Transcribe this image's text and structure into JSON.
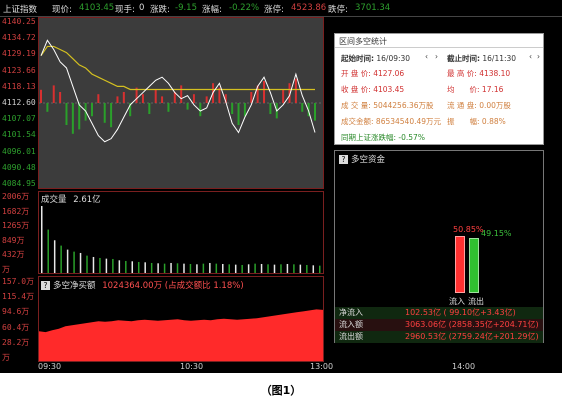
{
  "header": {
    "index_name": "上证指数",
    "current_label": "现价:",
    "current_value": "4103.45",
    "hand_label": "现手:",
    "hand_value": "0",
    "change_label": "涨跌:",
    "change_value": "-9.15",
    "pct_label": "涨幅:",
    "pct_value": "-0.22%",
    "limit_up_label": "涨停:",
    "limit_up_value": "4523.86",
    "limit_down_label": "跌停:",
    "limit_down_value": "3701.34"
  },
  "price_axis": [
    "4140.25",
    "4134.72",
    "4129.19",
    "4123.66",
    "4118.13",
    "4112.60",
    "4107.07",
    "4101.54",
    "4096.01",
    "4090.48",
    "4084.95"
  ],
  "volume_pane": {
    "label": "成交量",
    "value": "2.61亿",
    "axis": [
      "2006万",
      "1682万",
      "1265万",
      "849万",
      "432万",
      "万"
    ]
  },
  "net_pane": {
    "label": "多空净买额",
    "value": "1024364.00万",
    "ratio": "(占成交额比 1.18%)",
    "axis": [
      "157.0万",
      "115.4万",
      "94.6万",
      "60.4万",
      "28.2万",
      "万"
    ]
  },
  "time_axis": [
    "09:30",
    "10:30",
    "13:00",
    "14:00"
  ],
  "stats": {
    "title": "区间多空统计",
    "start_label": "起始时间:",
    "start_value": "16/09:30",
    "end_label": "截止时间:",
    "end_value": "16/11:30",
    "open_label": "开 盘 价:",
    "open_value": "4127.06",
    "high_label": "最 高 价:",
    "high_value": "4138.10",
    "close_label": "收 盘 价:",
    "close_value": "4103.45",
    "avg_label": "均　　价:",
    "avg_value": "17.16",
    "vol_label": "成 交 量:",
    "vol_value": "5044256.36万股",
    "float_label": "流 通 盘:",
    "float_value": "0.00万股",
    "amount_label": "成交金额:",
    "amount_value": "86534540.49万元",
    "swing_label": "振　　幅:",
    "swing_value": "0.88%",
    "period_label": "同期上证涨跌幅:",
    "period_value": "-0.57%"
  },
  "capital": {
    "title": "多空资金",
    "inflow_pct": "50.85%",
    "outflow_pct": "49.15%",
    "inflow_label": "流入",
    "outflow_label": "流出",
    "rows": [
      {
        "k": "净流入",
        "v": "102.53亿 ( 99.10亿+3.43亿)"
      },
      {
        "k": "流入额",
        "v": "3063.06亿 (2858.35亿+204.71亿)"
      },
      {
        "k": "流出额",
        "v": "2960.53亿 (2759.24亿+201.29亿)"
      }
    ]
  },
  "caption": "（图1）",
  "chart_data": {
    "type": "line",
    "price_range": [
      4084.95,
      4140.25
    ],
    "price_series": [
      4128,
      4133,
      4130,
      4126,
      4124,
      4118,
      4112,
      4110,
      4106,
      4102,
      4100,
      4101,
      4104,
      4108,
      4112,
      4114,
      4116,
      4118,
      4120,
      4121,
      4119,
      4116,
      4114,
      4115,
      4112,
      4110,
      4111,
      4116,
      4119,
      4113,
      4106,
      4103,
      4108,
      4112,
      4118,
      4121,
      4116,
      4110,
      4112,
      4115,
      4122,
      4115,
      4110,
      4103
    ],
    "avg_series": [
      4128,
      4131,
      4131,
      4130,
      4129,
      4127,
      4125,
      4124,
      4122,
      4121,
      4120,
      4119,
      4118,
      4118,
      4117,
      4117,
      4117,
      4117,
      4117,
      4117,
      4117,
      4117,
      4117,
      4117,
      4117,
      4117,
      4117,
      4117,
      4117,
      4117,
      4117,
      4117,
      4117,
      4117,
      4117,
      4117,
      4117,
      4117,
      4117,
      4117,
      4117,
      4117,
      4117,
      4117
    ],
    "bars": [
      6,
      -4,
      8,
      5,
      -10,
      -14,
      -12,
      -8,
      -6,
      4,
      -9,
      -11,
      3,
      5,
      -6,
      7,
      4,
      -5,
      6,
      3,
      -4,
      5,
      8,
      -3,
      4,
      -6,
      3,
      9,
      7,
      4,
      -5,
      -10,
      -6,
      5,
      8,
      10,
      -5,
      -7,
      6,
      9,
      11,
      -4,
      -6,
      -8
    ],
    "volume": [
      2006,
      1300,
      980,
      820,
      700,
      640,
      600,
      520,
      480,
      450,
      430,
      420,
      380,
      360,
      350,
      330,
      320,
      300,
      290,
      280,
      300,
      290,
      280,
      270,
      260,
      280,
      300,
      280,
      270,
      260,
      250,
      240,
      260,
      280,
      270,
      260,
      250,
      260,
      270,
      260,
      250,
      240,
      230,
      220
    ],
    "volume_range": [
      0,
      2006
    ],
    "net_buy": [
      60,
      58,
      62,
      65,
      70,
      72,
      74,
      76,
      78,
      80,
      79,
      80,
      82,
      81,
      80,
      82,
      83,
      82,
      81,
      82,
      83,
      84,
      82,
      81,
      82,
      83,
      82,
      84,
      85,
      84,
      83,
      84,
      85,
      86,
      88,
      90,
      92,
      94,
      96,
      98,
      100,
      102,
      104,
      103
    ],
    "net_range": [
      0,
      157
    ],
    "inflow_pct": 50.85,
    "outflow_pct": 49.15
  }
}
